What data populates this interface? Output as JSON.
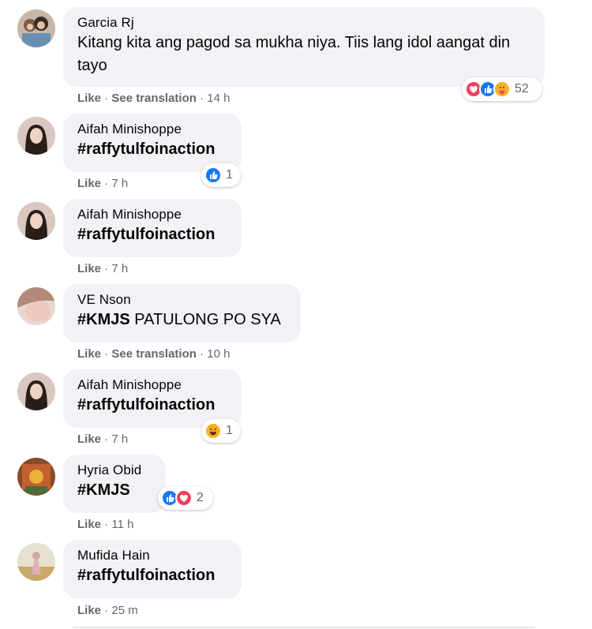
{
  "comments": [
    {
      "author": "Garcia Rj",
      "text": "Kitang kita ang pagod sa mukha niya. Tiis lang idol aangat din tayo",
      "actions": {
        "like": "Like",
        "translate": "See translation",
        "time": "14 h"
      },
      "reactions": {
        "icons": [
          "heart-icon",
          "like-icon",
          "care-icon"
        ],
        "count": "52"
      }
    },
    {
      "author": "Aifah Minishoppe",
      "text": "#raffytulfoinaction",
      "actions": {
        "like": "Like",
        "time": "7 h"
      },
      "reactions": {
        "icons": [
          "like-icon"
        ],
        "count": "1"
      }
    },
    {
      "author": "Aifah Minishoppe",
      "text": "#raffytulfoinaction",
      "actions": {
        "like": "Like",
        "time": "7 h"
      }
    },
    {
      "author": "VE Nson",
      "text_tag": "#KMJS",
      "text_rest": " PATULONG PO SYA",
      "actions": {
        "like": "Like",
        "translate": "See translation",
        "time": "10 h"
      }
    },
    {
      "author": "Aifah Minishoppe",
      "text": "#raffytulfoinaction",
      "actions": {
        "like": "Like",
        "time": "7 h"
      },
      "reactions": {
        "icons": [
          "haha-icon"
        ],
        "count": "1"
      }
    },
    {
      "author": "Hyria Obid",
      "text": "#KMJS",
      "actions": {
        "like": "Like",
        "time": "11 h"
      },
      "reactions": {
        "icons": [
          "like-icon",
          "heart-icon"
        ],
        "count": "2"
      }
    },
    {
      "author": "Mufida Hain",
      "text": "#raffytulfoinaction",
      "actions": {
        "like": "Like",
        "time": "25 m"
      }
    }
  ],
  "separator": " · ",
  "colors": {
    "like": "#1877f2",
    "heart": "#f33e58",
    "care": "#f7b125",
    "bubble": "#f0f2f5",
    "meta": "#65676b"
  }
}
